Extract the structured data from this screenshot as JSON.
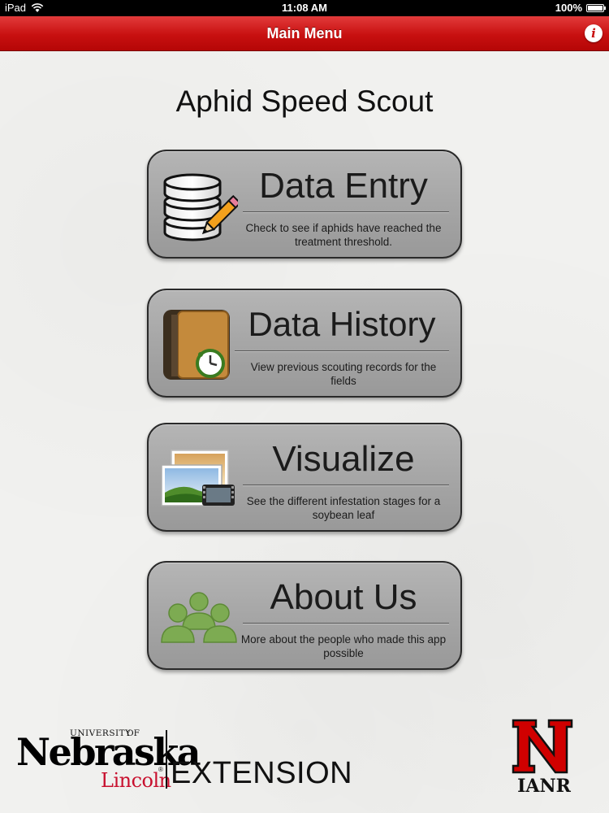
{
  "status_bar": {
    "device": "iPad",
    "time": "11:08 AM",
    "battery": "100%"
  },
  "nav_bar": {
    "title": "Main Menu",
    "info_label": "i"
  },
  "app_title": "Aphid Speed Scout",
  "menu": [
    {
      "label": "Data Entry",
      "description": "Check to see if aphids have reached the treatment threshold.",
      "icon": "database-pencil-icon"
    },
    {
      "label": "Data History",
      "description": "View previous scouting records for the fields",
      "icon": "history-book-clock-icon"
    },
    {
      "label": "Visualize",
      "description": "See the different infestation stages for a soybean leaf",
      "icon": "photos-icon"
    },
    {
      "label": "About Us",
      "description": "More about the people who made this app possible",
      "icon": "people-group-icon"
    }
  ],
  "footer": {
    "unl_university": "UNIVERSITY",
    "unl_of": "OF",
    "unl_name": "Nebraska",
    "unl_campus": "Lincoln",
    "unl_unit": "EXTENSION",
    "ianr": "IANR"
  },
  "colors": {
    "nav_red": "#c81010",
    "button_gray": "#a6a6a6",
    "nebraska_red": "#c8102e"
  }
}
